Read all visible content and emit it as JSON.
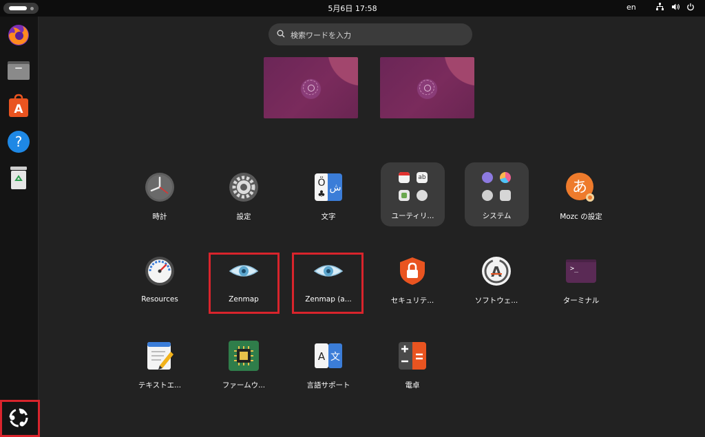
{
  "topbar": {
    "clock": "5月6日  17:58",
    "input_lang": "en"
  },
  "dock": {
    "items": [
      {
        "icon": "firefox-icon"
      },
      {
        "icon": "files-icon"
      },
      {
        "icon": "app-center-icon"
      },
      {
        "icon": "help-icon"
      },
      {
        "icon": "trash-icon"
      }
    ],
    "show_apps_icon": "ubuntu-logo-icon"
  },
  "search": {
    "placeholder": "検索ワードを入力"
  },
  "apps": {
    "row1": [
      {
        "label": "時計",
        "icon": "clock-icon"
      },
      {
        "label": "設定",
        "icon": "settings-gear-icon"
      },
      {
        "label": "文字",
        "icon": "characters-icon"
      },
      {
        "label": "ユーティリ...",
        "icon": "utilities-folder"
      },
      {
        "label": "システム",
        "icon": "system-folder"
      },
      {
        "label": "Mozc の設定",
        "icon": "mozc-icon"
      }
    ],
    "row2": [
      {
        "label": "Resources",
        "icon": "resources-gauge-icon"
      },
      {
        "label": "Zenmap",
        "icon": "zenmap-eye-icon"
      },
      {
        "label": "Zenmap (a...",
        "icon": "zenmap-eye-icon"
      },
      {
        "label": "セキュリテ...",
        "icon": "security-lock-icon"
      },
      {
        "label": "ソフトウェ...",
        "icon": "software-updater-icon"
      },
      {
        "label": "ターミナル",
        "icon": "terminal-icon"
      }
    ],
    "row3": [
      {
        "label": "テキストエ...",
        "icon": "text-editor-icon"
      },
      {
        "label": "ファームウ...",
        "icon": "firmware-chip-icon"
      },
      {
        "label": "言語サポート",
        "icon": "language-support-icon"
      },
      {
        "label": "電卓",
        "icon": "calculator-icon"
      }
    ]
  },
  "terminal_prompt": ">_",
  "language_glyphs": {
    "latin": "A",
    "kanji": "文"
  },
  "mozc_glyph": "あ",
  "characters_glyphs": {
    "latin": "Ö",
    "arabic": "ش"
  },
  "highlight_color": "#d9242c",
  "accent_orange": "#e95420"
}
